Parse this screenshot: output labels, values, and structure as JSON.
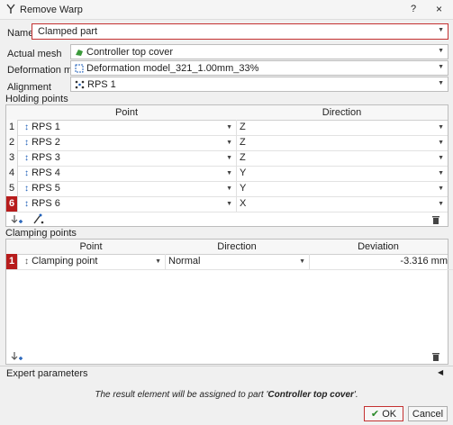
{
  "window": {
    "title": "Remove Warp",
    "help": "?",
    "close": "×"
  },
  "form": {
    "name_label": "Name",
    "name_value": "Clamped part",
    "actual_mesh_label": "Actual mesh",
    "actual_mesh_value": "Controller top cover",
    "deformation_model_label": "Deformation model",
    "deformation_model_value": "Deformation model_321_1.00mm_33%",
    "alignment_label": "Alignment",
    "alignment_value": "RPS 1"
  },
  "holding": {
    "title": "Holding points",
    "col_point": "Point",
    "col_direction": "Direction",
    "rows": [
      {
        "n": "1",
        "point": "RPS 1",
        "direction": "Z"
      },
      {
        "n": "2",
        "point": "RPS 2",
        "direction": "Z"
      },
      {
        "n": "3",
        "point": "RPS 3",
        "direction": "Z"
      },
      {
        "n": "4",
        "point": "RPS 4",
        "direction": "Y"
      },
      {
        "n": "5",
        "point": "RPS 5",
        "direction": "Y"
      },
      {
        "n": "6",
        "point": "RPS 6",
        "direction": "X"
      }
    ]
  },
  "clamping": {
    "title": "Clamping points",
    "col_point": "Point",
    "col_direction": "Direction",
    "col_deviation": "Deviation",
    "rows": [
      {
        "n": "1",
        "point": "Clamping point",
        "direction": "Normal",
        "deviation": "-3.316 mm"
      }
    ]
  },
  "expert": {
    "label": "Expert parameters"
  },
  "footer": {
    "message_prefix": "The result element will be assigned to part '",
    "message_part": "Controller top cover",
    "message_suffix": "'.",
    "ok_label": "OK",
    "cancel_label": "Cancel"
  },
  "icons": {
    "window": "warp-icon",
    "mesh": "mesh-icon",
    "deformation": "deformation-icon",
    "alignment": "alignment-icon",
    "point_row": "point-icon",
    "add_point": "add-point-icon",
    "pick_point": "pick-point-icon",
    "delete": "trash-icon",
    "collapse": "collapse-arrow-icon",
    "ok": "check-icon"
  },
  "colors": {
    "accent_red": "#c43131",
    "selected_row": "#b71c1c",
    "point_icon": "#1f5fb8"
  }
}
